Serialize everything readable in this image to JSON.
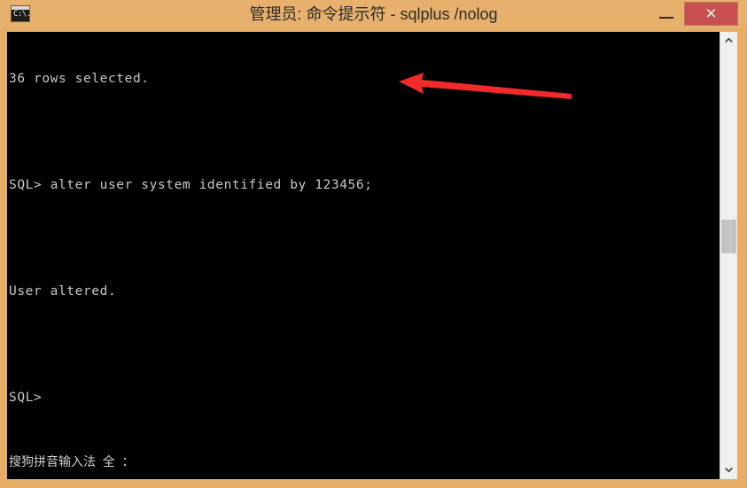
{
  "window": {
    "title": "管理员: 命令提示符 - sqlplus  /nolog",
    "icon_name": "console-window-icon",
    "icon_prompt": "C:\\.",
    "frame_color": "#e6ad66",
    "titlebar_color": "#e7b06c",
    "close_color": "#c8504f",
    "controls": {
      "minimize_label": "",
      "maximize_label": "",
      "close_label": "✕"
    }
  },
  "console": {
    "background": "#000000",
    "foreground": "#c8c8c8",
    "lines": [
      "36 rows selected.",
      "",
      "SQL> alter user system identified by 123456;",
      "",
      "User altered.",
      "",
      "SQL>"
    ],
    "ime_status": "搜狗拼音输入法  全  ："
  },
  "annotation": {
    "arrow_color": "#f22a2a",
    "arrow_name": "red-pointer-arrow",
    "arrow_points_to": "SQL> alter user system identified by 123456;"
  },
  "scrollbar": {
    "up_arrow": "scroll-up-chevron",
    "down_arrow": "scroll-down-chevron",
    "thumb_name": "scrollbar-thumb",
    "track_color": "#f0f0f0",
    "thumb_color": "#c4c4c4"
  }
}
